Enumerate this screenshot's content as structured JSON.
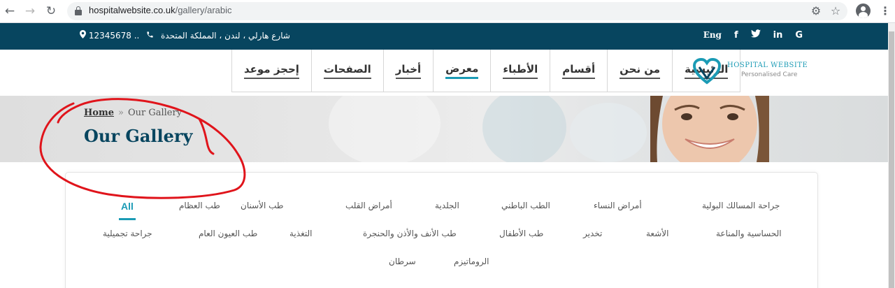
{
  "browser": {
    "url_host": "hospitalwebsite.co.uk",
    "url_path": "/gallery/arabic",
    "back_icon": "←",
    "forward_icon": "→",
    "reload_icon": "↻",
    "extension_icon": "⚙",
    "star_icon": "☆",
    "menu_icon": "⋮"
  },
  "topbar": {
    "address": "شارع هارلي ، لندن ، المملكة المتحدة",
    "phone": "12345678 ..",
    "lang": "Eng",
    "social": [
      "f",
      "𝕥",
      "in",
      "G"
    ]
  },
  "menu": [
    {
      "label": "الرئيسية",
      "active": false
    },
    {
      "label": "من نحن",
      "active": false
    },
    {
      "label": "أقسام",
      "active": false
    },
    {
      "label": "الأطباء",
      "active": false
    },
    {
      "label": "معرض",
      "active": true
    },
    {
      "label": "أخبار",
      "active": false
    },
    {
      "label": "الصفحات",
      "active": false
    },
    {
      "label": "إحجز موعد",
      "active": false
    }
  ],
  "logo": {
    "brand": "HOSPITAL WEBSITE",
    "tagline": "Personalised Care"
  },
  "banner": {
    "breadcrumb_home": "Home",
    "breadcrumb_sep": "»",
    "breadcrumb_current": "Our Gallery",
    "title": "Our Gallery"
  },
  "filters": {
    "all": "All",
    "row1": [
      "جراحة المسالك البولية",
      "أمراض النساء",
      "الطب الباطني",
      "الجلدية",
      "أمراض القلب",
      "طب الأسنان",
      "طب العظام"
    ],
    "row2": [
      "الحساسية والمناعة",
      "الأشعة",
      "تخدير",
      "طب الأطفال",
      "طب الأنف والأذن والحنجرة",
      "التغذية",
      "طب العيون العام",
      "جراحة تجميلية"
    ],
    "row3": [
      "الروماتيزم",
      "سرطان"
    ]
  },
  "colors": {
    "topbar": "#07455f",
    "accent": "#1b9bb5",
    "annotation": "#e0141b"
  }
}
